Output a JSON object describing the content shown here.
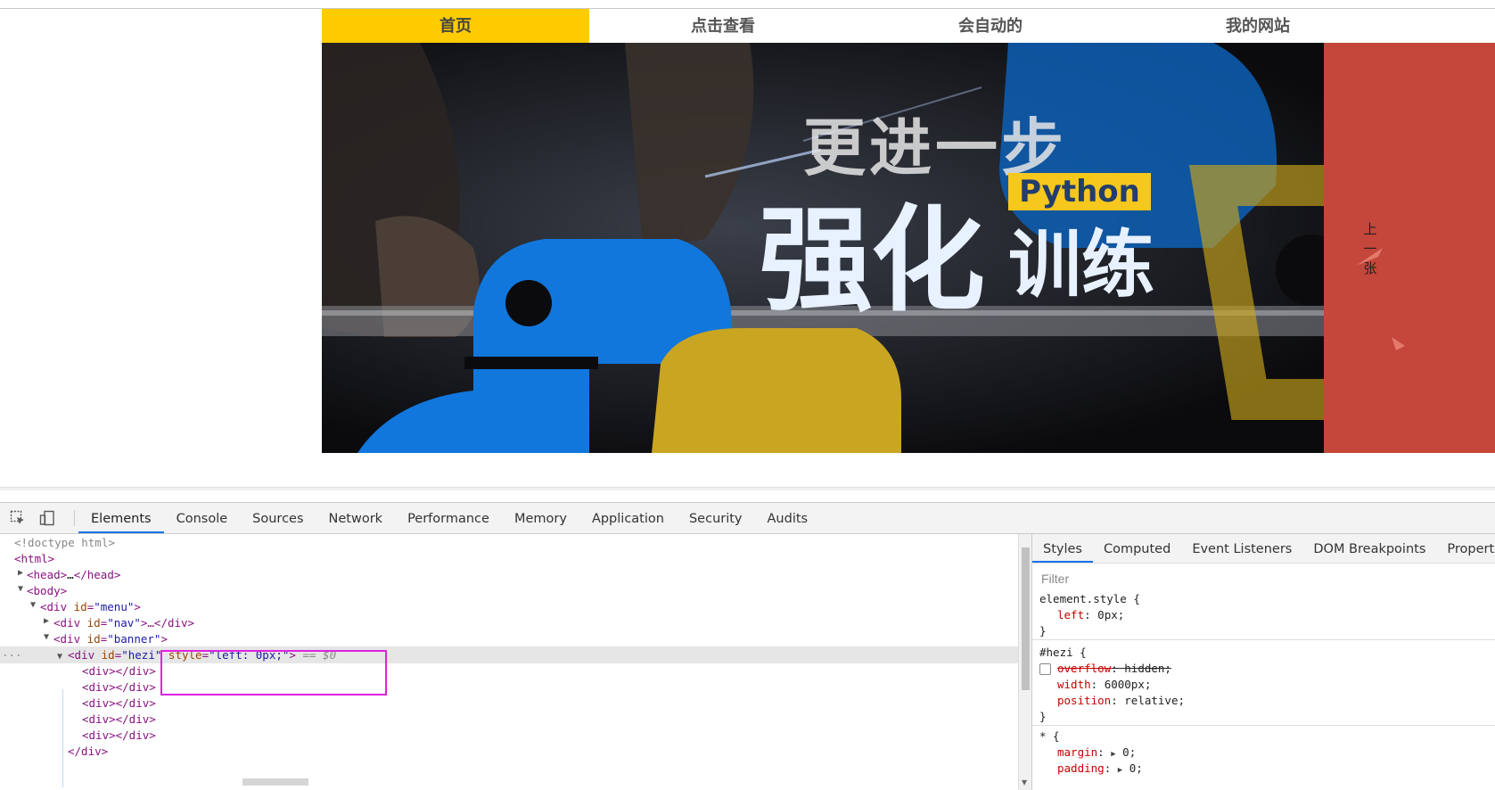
{
  "page": {
    "nav": [
      {
        "label": "首页",
        "active": true
      },
      {
        "label": "点击查看",
        "active": false
      },
      {
        "label": "会自动的",
        "active": false
      },
      {
        "label": "我的网站",
        "active": false
      }
    ],
    "banner": {
      "line1": "更进一步",
      "line2": "强化",
      "line3": "训练",
      "tag": "Python",
      "prev_label": "上一张",
      "colors": {
        "yellow": "#f6c71c",
        "blue": "#1177dd",
        "red": "#c5463a"
      }
    }
  },
  "devtools": {
    "tabs": [
      "Elements",
      "Console",
      "Sources",
      "Network",
      "Performance",
      "Memory",
      "Application",
      "Security",
      "Audits"
    ],
    "active_tab": "Elements",
    "dom": {
      "doctype": "<!doctype html>",
      "html": "<html>",
      "head_open": "<head>",
      "head_ellipsis": "…",
      "head_close": "</head>",
      "body": "<body>",
      "menu_open": "<div ",
      "menu_attr": "id",
      "menu_val": "\"menu\"",
      "nav_attr": "id",
      "nav_val": "\"nav\"",
      "banner_attr": "id",
      "banner_val": "\"banner\"",
      "hezi_attr": "id",
      "hezi_val": "\"hezi\"",
      "style_attr": "style",
      "style_val": "\"left: 0px;\"",
      "dollar": "== $0",
      "div_pair": "<div></div>",
      "div_close": "</div>",
      "tag_close": ">",
      "tag_ellipsis_close": ">…</div>",
      "more": "..."
    },
    "styles": {
      "tabs": [
        "Styles",
        "Computed",
        "Event Listeners",
        "DOM Breakpoints",
        "Properties"
      ],
      "active_tab": "Styles",
      "filter_placeholder": "Filter",
      "rules": {
        "element_selector": "element.style {",
        "element_prop": "left",
        "element_val": "0px;",
        "hezi_selector": "#hezi {",
        "overflow_prop": "overflow",
        "overflow_val": "hidden;",
        "width_prop": "width",
        "width_val": "6000px;",
        "position_prop": "position",
        "position_val": "relative;",
        "star_selector": "* {",
        "margin_prop": "margin",
        "margin_val": "0;",
        "padding_prop": "padding",
        "padding_val": "0;",
        "close": "}"
      }
    }
  }
}
